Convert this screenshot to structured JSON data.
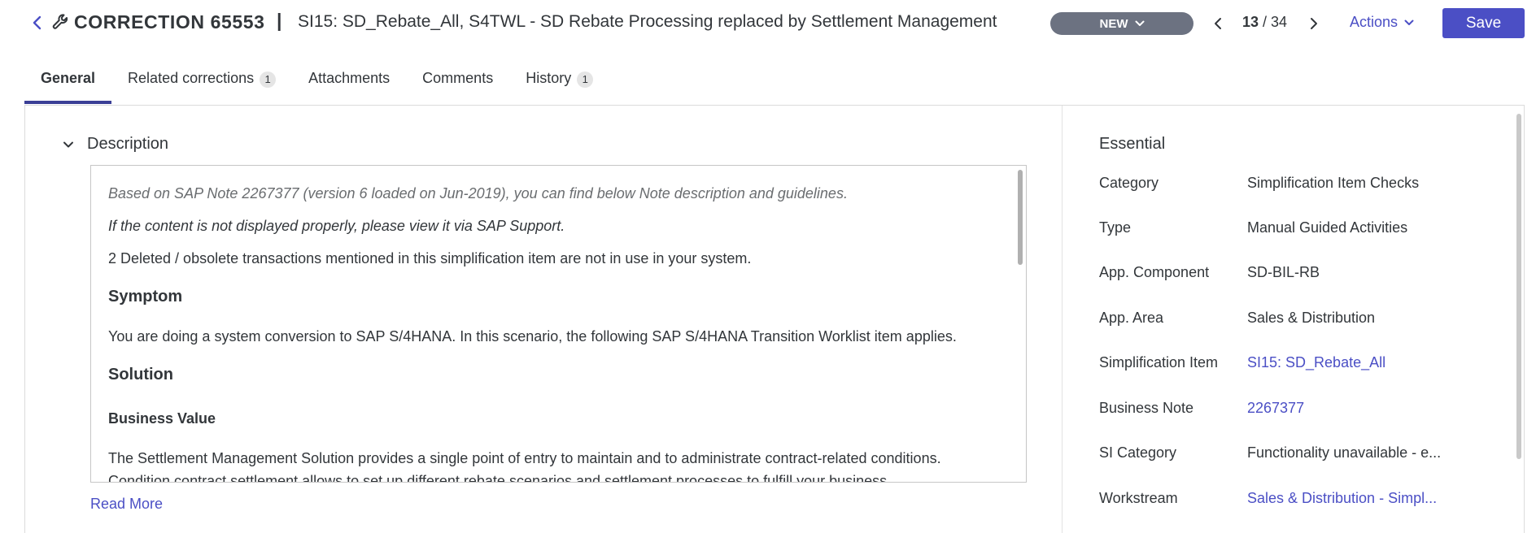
{
  "header": {
    "title_prefix": "CORRECTION 65553",
    "title_separator": "|",
    "title": "SI15: SD_Rebate_All, S4TWL - SD Rebate Processing replaced by Settlement Management",
    "status": "NEW",
    "pager_current": "13",
    "pager_total": "/ 34",
    "actions_label": "Actions",
    "save_label": "Save",
    "accent_color": "#4b4fc5"
  },
  "tabs": [
    {
      "label": "General",
      "count": ""
    },
    {
      "label": "Related corrections",
      "count": "1"
    },
    {
      "label": "Attachments",
      "count": ""
    },
    {
      "label": "Comments",
      "count": ""
    },
    {
      "label": "History",
      "count": "1"
    }
  ],
  "description": {
    "section_title": "Description",
    "intro_note": "Based on SAP Note 2267377 (version 6 loaded on Jun-2019), you can find below Note description and guidelines.",
    "display_note": "If the content is not displayed properly, please view it via SAP Support.",
    "deleted_tx": "2 Deleted / obsolete transactions mentioned in this simplification item are not in use in your system.",
    "symptom_heading": "Symptom",
    "symptom_text": "You are doing a system conversion to SAP S/4HANA. In this scenario, the following SAP S/4HANA Transition Worklist item applies.",
    "solution_heading": "Solution",
    "business_value_heading": "Business Value",
    "business_value_text": "The Settlement Management Solution provides a single point of entry to maintain and to administrate contract-related conditions.",
    "business_value_text_2": "Condition contract settlement allows to set up different rebate scenarios and settlement processes to fulfill your business",
    "read_more": "Read More"
  },
  "essential": {
    "title": "Essential",
    "rows": [
      {
        "label": "Category",
        "value": "Simplification Item Checks"
      },
      {
        "label": "Type",
        "value": "Manual Guided Activities"
      },
      {
        "label": "App. Component",
        "value": "SD-BIL-RB"
      },
      {
        "label": "App. Area",
        "value": "Sales & Distribution"
      },
      {
        "label": "Simplification Item",
        "value": "SI15: SD_Rebate_All"
      },
      {
        "label": "Business Note",
        "value": "2267377"
      },
      {
        "label": "SI Category",
        "value": "Functionality unavailable - e..."
      },
      {
        "label": "Workstream",
        "value": "Sales & Distribution - Simpl..."
      }
    ]
  },
  "icons": {
    "back": "chevron-left-icon",
    "entity": "wrench-icon",
    "status_dropdown": "chevron-down-icon",
    "pager_prev": "chevron-left-icon",
    "pager_next": "chevron-right-icon",
    "actions_dropdown": "chevron-down-icon",
    "section_toggle": "chevron-down-icon"
  }
}
